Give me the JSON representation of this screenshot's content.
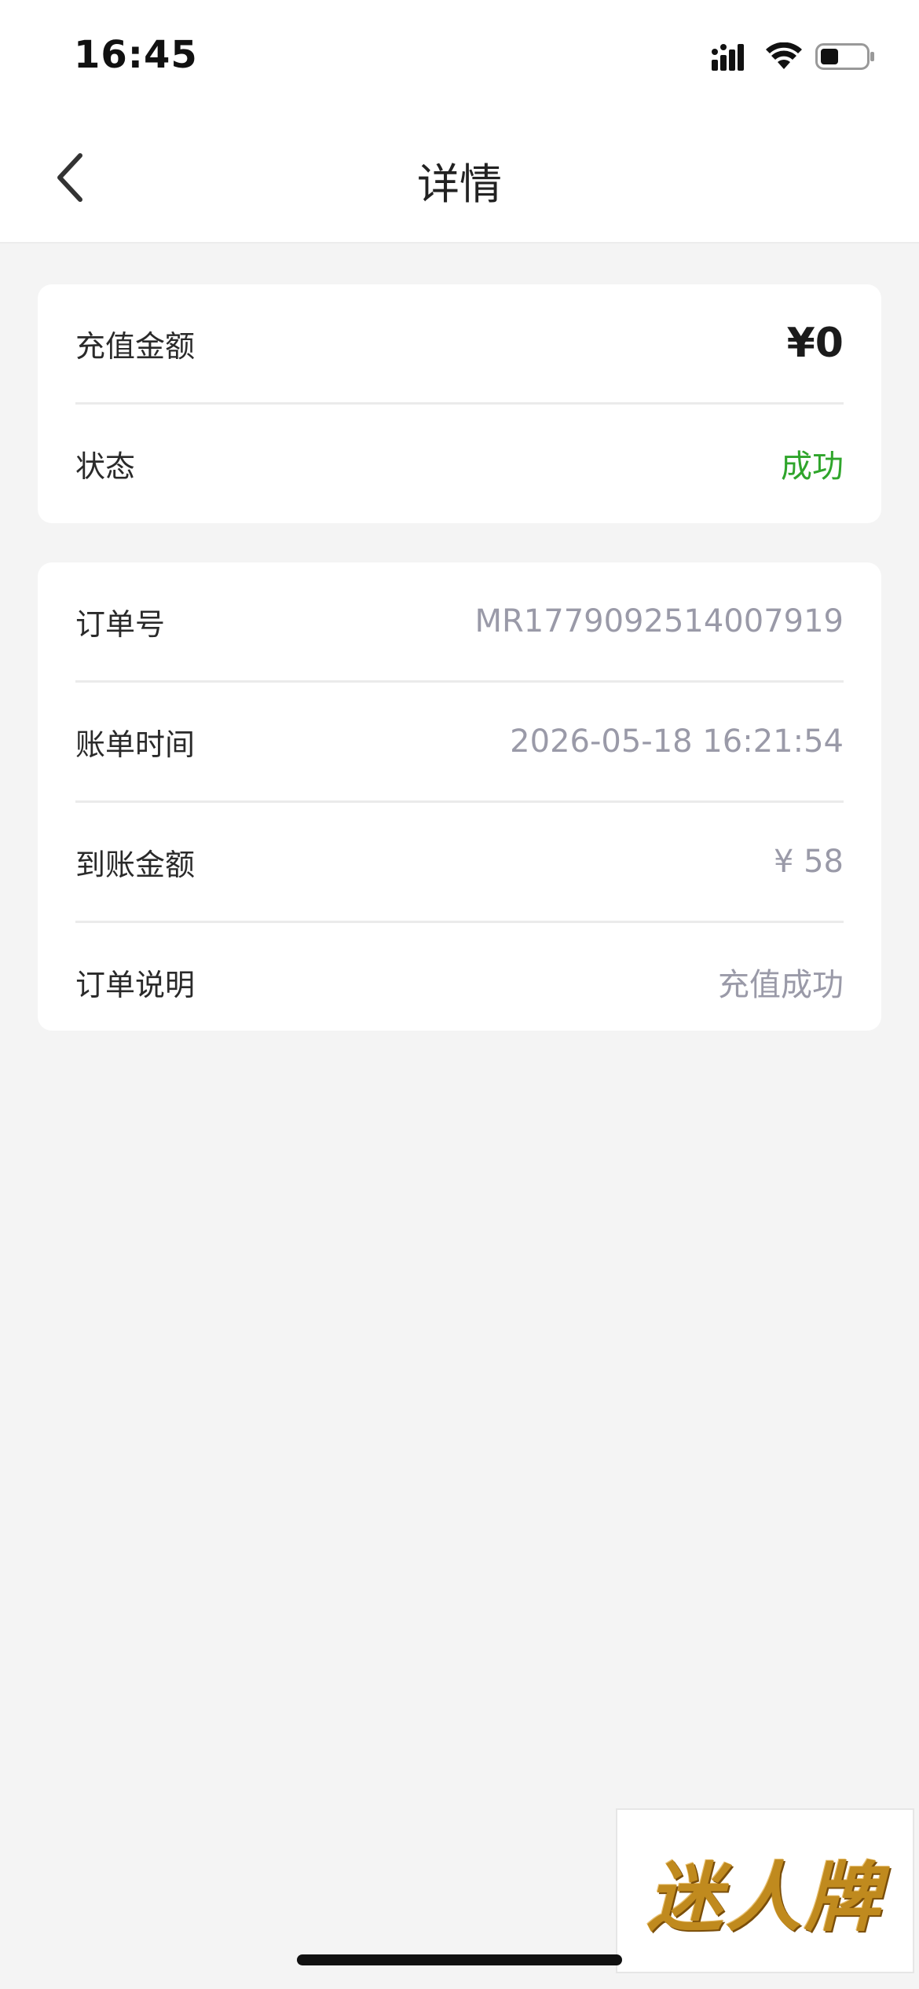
{
  "status_bar": {
    "time": "16:45"
  },
  "header": {
    "title": "详情"
  },
  "summary": {
    "amount_label": "充值金额",
    "amount_value": "¥0",
    "status_label": "状态",
    "status_value": "成功",
    "status_color": "#2fa52b"
  },
  "details": {
    "rows": [
      {
        "label": "订单号",
        "value": "MR1779092514007919"
      },
      {
        "label": "账单时间",
        "value": "2026-05-18 16:21:54"
      },
      {
        "label": "到账金额",
        "value": "¥ 58"
      },
      {
        "label": "订单说明",
        "value": "充值成功"
      }
    ]
  },
  "watermark": {
    "text": "迷人牌"
  },
  "icons": [
    "signal-icon",
    "wifi-icon",
    "battery-icon",
    "back-arrow-icon"
  ]
}
